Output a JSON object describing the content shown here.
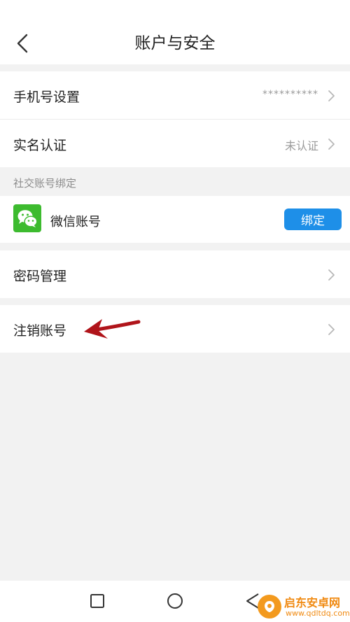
{
  "header": {
    "title": "账户与安全",
    "back_icon": "chevron-left-icon"
  },
  "rows": {
    "phone": {
      "label": "手机号设置",
      "value": "**********"
    },
    "realname": {
      "label": "实名认证",
      "value": "未认证"
    },
    "password": {
      "label": "密码管理"
    },
    "cancel": {
      "label": "注销账号"
    }
  },
  "social": {
    "section_header": "社交账号绑定",
    "wechat_label": "微信账号",
    "wechat_icon": "wechat-icon",
    "bind_label": "绑定"
  },
  "annotation": {
    "arrow_color": "#b0141a"
  },
  "colors": {
    "accent": "#1e8fe8",
    "wechat_green": "#3dbb2f",
    "background": "#f2f2f2"
  },
  "watermark": {
    "title": "启东安卓网",
    "url": "www.qdltdq.com"
  },
  "navbar": {
    "icons": [
      "square-icon",
      "circle-icon",
      "triangle-back-icon"
    ]
  }
}
